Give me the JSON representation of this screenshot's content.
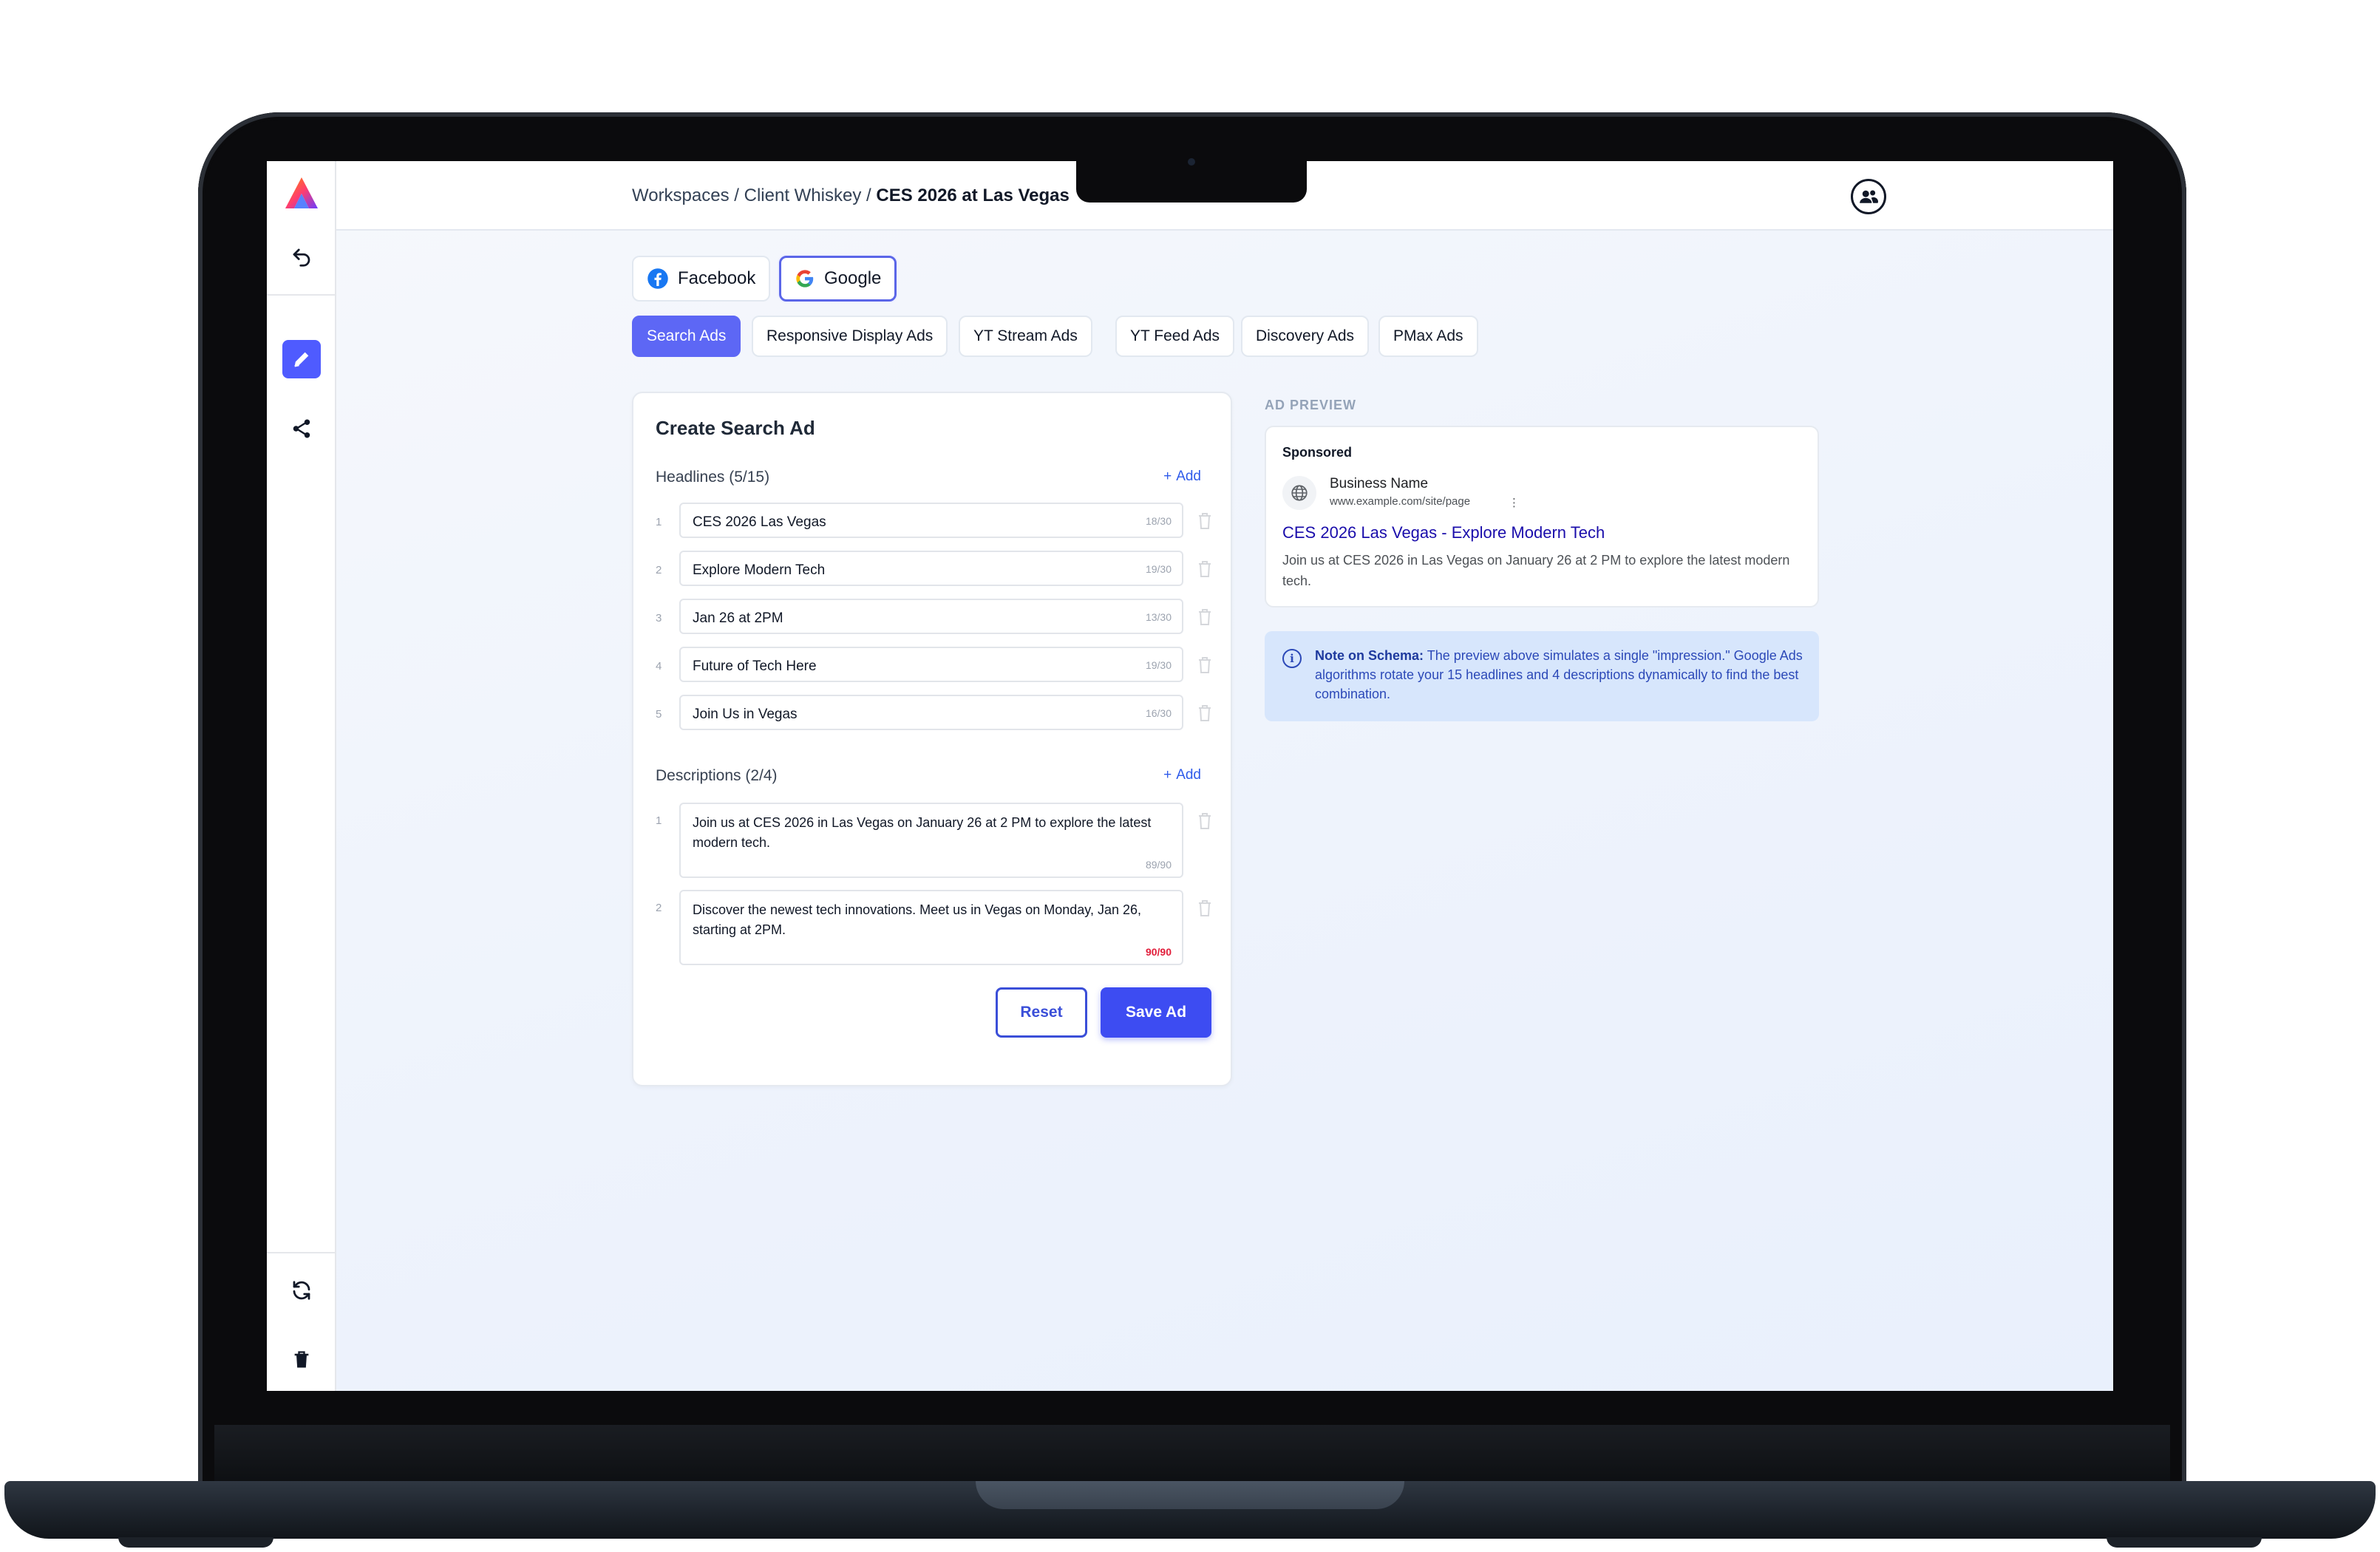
{
  "app": {
    "logo": "brand-logo",
    "breadcrumb": {
      "items": [
        "Workspaces",
        "Client Whiskey"
      ],
      "current": "CES 2026 at Las Vegas",
      "separator": "/"
    },
    "user_icon": "users-icon"
  },
  "sidebar": {
    "top_items": [
      {
        "icon": "undo-icon"
      },
      {
        "icon": "pencil-icon",
        "active": true
      },
      {
        "icon": "share-icon"
      }
    ],
    "bottom_items": [
      {
        "icon": "refresh-icon"
      },
      {
        "icon": "trash-icon"
      }
    ]
  },
  "platforms": [
    {
      "label": "Facebook",
      "icon": "facebook-icon",
      "selected": false
    },
    {
      "label": "Google",
      "icon": "google-icon",
      "selected": true
    }
  ],
  "ad_types": [
    {
      "label": "Search Ads",
      "active": true
    },
    {
      "label": "Responsive Display Ads",
      "active": false
    },
    {
      "label": "YT Stream Ads",
      "active": false
    },
    {
      "label": "YT Feed Ads",
      "active": false
    },
    {
      "label": "Discovery Ads",
      "active": false
    },
    {
      "label": "PMax Ads",
      "active": false
    }
  ],
  "form": {
    "title": "Create Search Ad",
    "headlines": {
      "title": "Headlines (5/15)",
      "add_label": "Add",
      "items": [
        {
          "num": "1",
          "text": "CES 2026 Las Vegas",
          "count": "18/30"
        },
        {
          "num": "2",
          "text": "Explore Modern Tech",
          "count": "19/30"
        },
        {
          "num": "3",
          "text": "Jan 26 at 2PM",
          "count": "13/30"
        },
        {
          "num": "4",
          "text": "Future of Tech Here",
          "count": "19/30"
        },
        {
          "num": "5",
          "text": "Join Us in Vegas",
          "count": "16/30"
        }
      ]
    },
    "descriptions": {
      "title": "Descriptions (2/4)",
      "add_label": "Add",
      "items": [
        {
          "num": "1",
          "text": "Join us at CES 2026 in Las Vegas on January 26 at 2 PM to explore the latest modern tech.",
          "count": "89/90"
        },
        {
          "num": "2",
          "text": "Discover the newest tech innovations. Meet us in Vegas on Monday, Jan 26, starting at 2PM.",
          "count": "90/90"
        }
      ]
    },
    "reset_label": "Reset",
    "save_label": "Save Ad"
  },
  "preview": {
    "label": "AD PREVIEW",
    "sponsored": "Sponsored",
    "business_name": "Business Name",
    "url": "www.example.com/site/page",
    "headline": "CES 2026 Las Vegas - Explore Modern Tech",
    "description": "Join us at CES 2026 in Las Vegas on January 26 at 2 PM to explore the latest modern tech."
  },
  "note": {
    "title": "Note on Schema:",
    "text": "The preview above simulates a single \"impression.\" Google Ads algorithms rotate your 15 headlines and 4 descriptions dynamically to find the best combination."
  },
  "colors": {
    "accent": "#4f5bff",
    "save_button": "#3d4cf2",
    "preview_headline": "#1a0dab",
    "char_limit_full": "#e11d3a",
    "note_bg": "#d7e6fc"
  }
}
